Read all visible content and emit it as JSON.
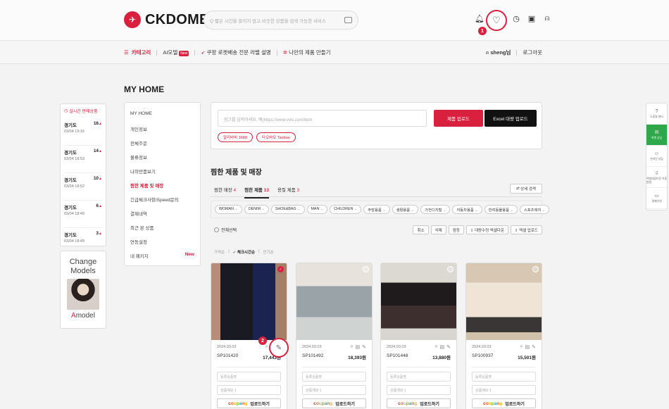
{
  "header": {
    "logo_text": "CKDOME",
    "search_placeholder": "Q 짧은 시간을 들이지 않고 비슷한 상품을 검색 가능한 서비스",
    "icons": [
      "bell-icon",
      "heart-icon",
      "clock-icon",
      "cart-icon",
      "user-icon"
    ],
    "step1": "1"
  },
  "nav": {
    "category": "카테고리",
    "ai_model": "AI모델",
    "new_badge": "New",
    "coupang_label": "쿠팡 로켓배송 전문 라벨 설명",
    "make_product": "나만의 제품 만들기",
    "user": "sheng님",
    "logout": "로그아웃"
  },
  "page": {
    "title": "MY HOME"
  },
  "realtime": {
    "title": "실시간 판매상품",
    "items": [
      {
        "region": "경기도",
        "count": "16",
        "time": "03/04 19:16"
      },
      {
        "region": "경기도",
        "count": "14",
        "time": "03/04 18:53"
      },
      {
        "region": "경기도",
        "count": "10",
        "time": "03/04 18:52"
      },
      {
        "region": "경기도",
        "count": "6",
        "time": "03/04 18:49"
      },
      {
        "region": "경기도",
        "count": "3",
        "time": "03/04 18:49"
      }
    ],
    "up_arrow": "▲"
  },
  "model_panel": {
    "title_line1": "Change",
    "title_line2": "Models",
    "name_a": "A",
    "name_rest": "model"
  },
  "menu": {
    "items": [
      {
        "label": "MY HOME"
      },
      {
        "label": "개인정보"
      },
      {
        "label": "전체주문"
      },
      {
        "label": "물류정보"
      },
      {
        "label": "나의반품보기"
      },
      {
        "label": "찜한 제품 및 매장"
      },
      {
        "label": "긴급체크사항/Speed문의"
      },
      {
        "label": "결제내역"
      },
      {
        "label": "최근 본 상품"
      },
      {
        "label": "연동설정"
      },
      {
        "label": "내 패키지"
      }
    ],
    "new_label": "New"
  },
  "upload": {
    "link_placeholder": "링크를 입력하세요. 예)https://www.vvic.com/item",
    "upload_btn": "제품 업로드",
    "excel_btn": "Excel 대량 업로드",
    "source1": "알리바바 1688",
    "source2": "타오바오 Taobao"
  },
  "section": {
    "title": "찜한 제품 및 매장",
    "tab1": "찜한 매장",
    "tab1_n": "4",
    "tab2": "찜한 제품",
    "tab2_n": "13",
    "tab3": "용질 제품",
    "tab3_n": "3",
    "detail_search": "상세 검색"
  },
  "filters": [
    "WOMAN",
    "DENIM",
    "SHOE&BAG",
    "MAN",
    "CHILDREN",
    "주방용품",
    "생활용품",
    "가전디지털",
    "자동차용품",
    "반려동물용품",
    "스포츠레저"
  ],
  "toolbar": {
    "select_all": "전체선택",
    "actions": [
      "취소",
      "삭제",
      "점정",
      "대량수정 엑셀다운",
      "엑셀 업로드"
    ]
  },
  "sort": {
    "price": "가격순",
    "check": "체크시간순",
    "popular": "인기순"
  },
  "products": [
    {
      "date": "2024.03.03",
      "sp": "SP101420",
      "price": "17,443원",
      "checked": true
    },
    {
      "date": "2024.03.03",
      "sp": "SP101492",
      "price": "18,393원",
      "checked": false
    },
    {
      "date": "2024.03.03",
      "sp": "SP101448",
      "price": "13,880원",
      "checked": false
    },
    {
      "date": "2024.03.03",
      "sp": "SP100937",
      "price": "15,501원",
      "checked": false
    }
  ],
  "card_fields": {
    "field1": "등록상품명",
    "field2": "상품메모 1",
    "upload_text": "업로드하기"
  },
  "step2": "2",
  "quick": [
    "도움말 센터",
    "위챗 상담",
    "온라인 상담",
    "엑셀대량다운 이용방법",
    "결제안내"
  ]
}
